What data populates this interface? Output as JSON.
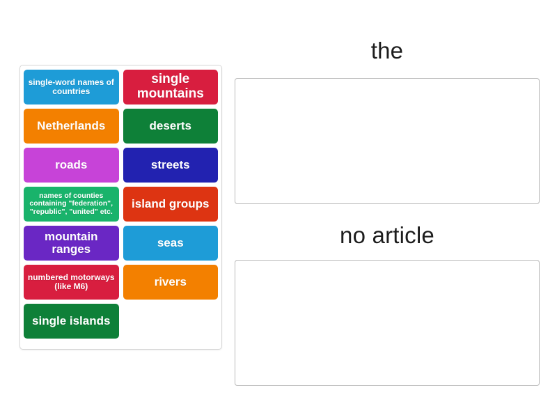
{
  "activity": {
    "type": "group-sort",
    "tile_text_color": "#ffffff"
  },
  "tray": {
    "name": "tile-tray",
    "tiles": [
      {
        "label": "single-word names of countries",
        "color": "#1e9cd7",
        "size": "s-sm"
      },
      {
        "label": "single mountains",
        "color": "#d81e3f",
        "size": "s-lg"
      },
      {
        "label": "Netherlands",
        "color": "#f38000",
        "size": "s-md"
      },
      {
        "label": "deserts",
        "color": "#0e8038",
        "size": "s-md"
      },
      {
        "label": "roads",
        "color": "#c743d8",
        "size": "s-md"
      },
      {
        "label": "streets",
        "color": "#2222b0",
        "size": "s-md"
      },
      {
        "label": "names of counties containing \"federation\", \"republic\", \"united\" etc.",
        "color": "#19b36b",
        "size": "s-xs"
      },
      {
        "label": "island groups",
        "color": "#dd3412",
        "size": "s-md"
      },
      {
        "label": "mountain ranges",
        "color": "#6a27c4",
        "size": "s-md"
      },
      {
        "label": "seas",
        "color": "#1e9cd7",
        "size": "s-md"
      },
      {
        "label": "numbered motorways (like M6)",
        "color": "#d81e3f",
        "size": "s-sm"
      },
      {
        "label": "rivers",
        "color": "#f38000",
        "size": "s-md"
      },
      {
        "label": "single islands",
        "color": "#0e8038",
        "size": "s-md"
      }
    ]
  },
  "groups": [
    {
      "heading": "the",
      "zone_name": "drop-zone-the",
      "items": []
    },
    {
      "heading": "no article",
      "zone_name": "drop-zone-noarticle",
      "items": []
    }
  ]
}
